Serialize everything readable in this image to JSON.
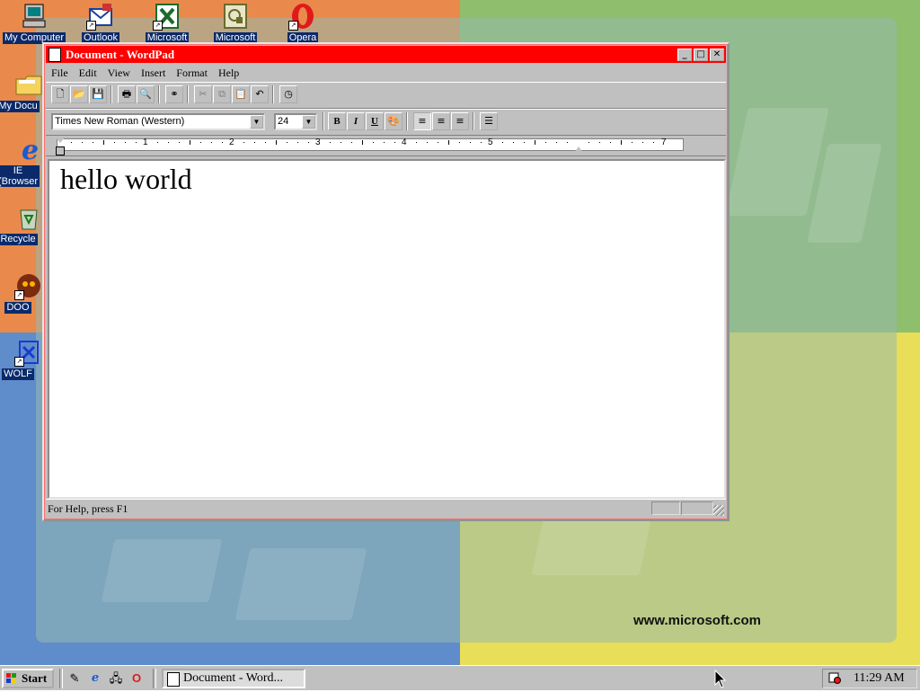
{
  "desktop": {
    "icons": [
      {
        "label": "My Computer",
        "icon": "computer-icon"
      },
      {
        "label": "Outlook",
        "icon": "outlook-icon"
      },
      {
        "label": "Microsoft",
        "icon": "excel-icon"
      },
      {
        "label": "Microsoft",
        "icon": "project-icon"
      },
      {
        "label": "Opera",
        "icon": "opera-icon"
      },
      {
        "label": "My Docu",
        "icon": "folder-icon"
      },
      {
        "label": "IE",
        "label2": "(Browser",
        "icon": "ie-icon"
      },
      {
        "label": "Recycle",
        "icon": "recycle-bin-icon"
      },
      {
        "label": "DOO",
        "icon": "doom-icon"
      },
      {
        "label": "WOLF",
        "icon": "wolf3d-icon"
      }
    ],
    "watermark": "www.microsoft.com"
  },
  "window": {
    "title": "Document - WordPad",
    "menu": [
      "File",
      "Edit",
      "View",
      "Insert",
      "Format",
      "Help"
    ],
    "font_name": "Times New Roman (Western)",
    "font_size": "24",
    "ruler_numbers": [
      "1",
      "2",
      "3",
      "4",
      "5",
      "7"
    ],
    "document_text": "hello world",
    "status_text": "For Help, press F1"
  },
  "taskbar": {
    "start_label": "Start",
    "task_label": "Document - Word...",
    "clock": "11:29 AM"
  },
  "colors": {
    "title_bar": "#ff0000",
    "desktop_orange": "#e98a4c",
    "desktop_green": "#8fbe6c",
    "desktop_blue": "#5f8ccb",
    "desktop_yellow": "#e9de58",
    "chrome": "#c0c0c0"
  }
}
